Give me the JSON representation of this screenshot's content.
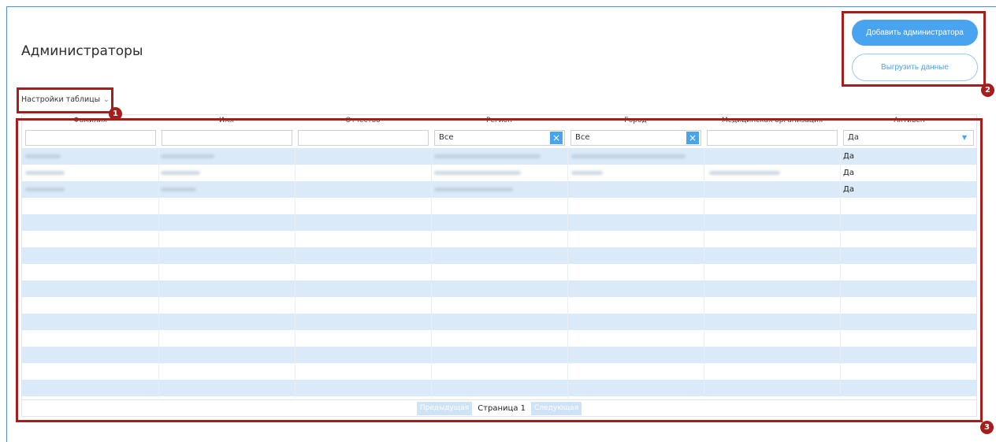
{
  "page": {
    "title": "Администраторы"
  },
  "actions": {
    "add_admin_label": "Добавить администратора",
    "export_label": "Выгрузить данные"
  },
  "table_settings": {
    "label": "Настройки таблицы"
  },
  "columns": [
    "Фамилия",
    "Имя",
    "Отчество",
    "Регион",
    "Город",
    "Медицинская организация",
    "Активен"
  ],
  "filters": {
    "region": {
      "value": "Все",
      "clear_icon": "close-icon"
    },
    "city": {
      "value": "Все",
      "clear_icon": "close-icon"
    },
    "active": {
      "value": "Да",
      "dropdown_icon": "chevron-down-icon"
    }
  },
  "rows": [
    {
      "active": "Да"
    },
    {
      "active": "Да"
    },
    {
      "active": "Да"
    }
  ],
  "pagination": {
    "prev_label": "Предыдущая",
    "page_label": "Страница 1",
    "next_label": "Следующая"
  },
  "annotations": [
    "1",
    "2",
    "3"
  ],
  "colors": {
    "accent": "#4aa3ee",
    "row_alt": "#dbeaf8",
    "highlight": "#a51d1d"
  }
}
